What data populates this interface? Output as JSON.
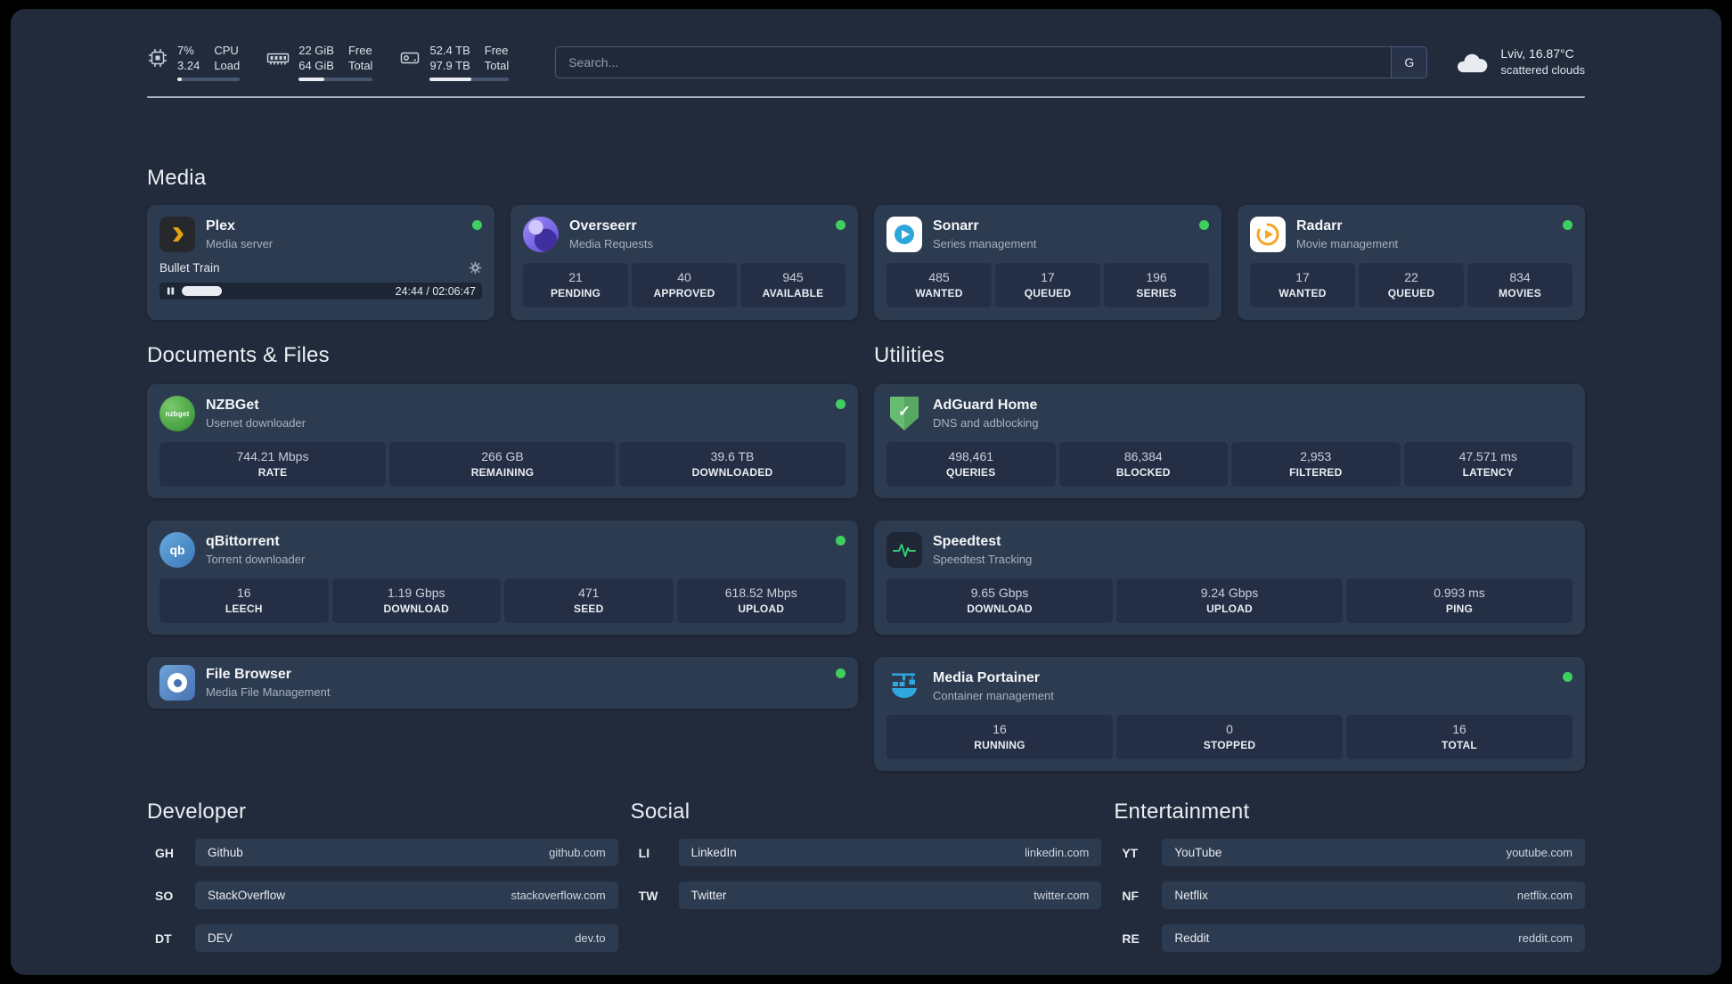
{
  "colors": {
    "background": "#212b3c",
    "card": "#2d3b50",
    "stat_box": "#242f46",
    "online_dot": "#3fcf5f",
    "speedtest_accent": "#2ecc71",
    "plex_amber": "#e5a00d"
  },
  "topbar": {
    "cpu": {
      "line1": "7%",
      "line2": "3.24",
      "label1": "CPU",
      "label2": "Load",
      "progress_pct": 7
    },
    "ram": {
      "line1": "22 GiB",
      "line2": "64 GiB",
      "label1": "Free",
      "label2": "Total",
      "progress_pct": 34
    },
    "disk": {
      "line1": "52.4 TB",
      "line2": "97.9 TB",
      "label1": "Free",
      "label2": "Total",
      "progress_pct": 53
    },
    "search": {
      "placeholder": "Search...",
      "engine_button": "G"
    },
    "weather": {
      "location": "Lviv, 16.87°C",
      "condition": "scattered clouds"
    }
  },
  "media": {
    "title": "Media",
    "plex": {
      "name": "Plex",
      "subtitle": "Media server",
      "now_playing": "Bullet Train",
      "time": "24:44 / 02:06:47",
      "progress_pct": 19.5
    },
    "overseerr": {
      "name": "Overseerr",
      "subtitle": "Media Requests",
      "stats": [
        {
          "value": "21",
          "label": "PENDING"
        },
        {
          "value": "40",
          "label": "APPROVED"
        },
        {
          "value": "945",
          "label": "AVAILABLE"
        }
      ]
    },
    "sonarr": {
      "name": "Sonarr",
      "subtitle": "Series management",
      "stats": [
        {
          "value": "485",
          "label": "WANTED"
        },
        {
          "value": "17",
          "label": "QUEUED"
        },
        {
          "value": "196",
          "label": "SERIES"
        }
      ]
    },
    "radarr": {
      "name": "Radarr",
      "subtitle": "Movie management",
      "stats": [
        {
          "value": "17",
          "label": "WANTED"
        },
        {
          "value": "22",
          "label": "QUEUED"
        },
        {
          "value": "834",
          "label": "MOVIES"
        }
      ]
    }
  },
  "documents": {
    "title": "Documents & Files",
    "nzbget": {
      "name": "NZBGet",
      "subtitle": "Usenet downloader",
      "icon_text": "nzbget",
      "stats": [
        {
          "value": "744.21 Mbps",
          "label": "RATE"
        },
        {
          "value": "266 GB",
          "label": "REMAINING"
        },
        {
          "value": "39.6 TB",
          "label": "DOWNLOADED"
        }
      ]
    },
    "qbittorrent": {
      "name": "qBittorrent",
      "subtitle": "Torrent downloader",
      "icon_text": "qb",
      "stats": [
        {
          "value": "16",
          "label": "LEECH"
        },
        {
          "value": "1.19 Gbps",
          "label": "DOWNLOAD"
        },
        {
          "value": "471",
          "label": "SEED"
        },
        {
          "value": "618.52 Mbps",
          "label": "UPLOAD"
        }
      ]
    },
    "filebrowser": {
      "name": "File Browser",
      "subtitle": "Media File Management"
    }
  },
  "utilities": {
    "title": "Utilities",
    "adguard": {
      "name": "AdGuard Home",
      "subtitle": "DNS and adblocking",
      "stats": [
        {
          "value": "498,461",
          "label": "QUERIES"
        },
        {
          "value": "86,384",
          "label": "BLOCKED"
        },
        {
          "value": "2,953",
          "label": "FILTERED"
        },
        {
          "value": "47.571 ms",
          "label": "LATENCY"
        }
      ]
    },
    "speedtest": {
      "name": "Speedtest",
      "subtitle": "Speedtest Tracking",
      "stats": [
        {
          "value": "9.65 Gbps",
          "label": "DOWNLOAD"
        },
        {
          "value": "9.24 Gbps",
          "label": "UPLOAD"
        },
        {
          "value": "0.993 ms",
          "label": "PING"
        }
      ]
    },
    "portainer": {
      "name": "Media Portainer",
      "subtitle": "Container management",
      "stats": [
        {
          "value": "16",
          "label": "RUNNING"
        },
        {
          "value": "0",
          "label": "STOPPED"
        },
        {
          "value": "16",
          "label": "TOTAL"
        }
      ]
    }
  },
  "links": {
    "developer": {
      "title": "Developer",
      "items": [
        {
          "abbr": "GH",
          "name": "Github",
          "domain": "github.com"
        },
        {
          "abbr": "SO",
          "name": "StackOverflow",
          "domain": "stackoverflow.com"
        },
        {
          "abbr": "DT",
          "name": "DEV",
          "domain": "dev.to"
        }
      ]
    },
    "social": {
      "title": "Social",
      "items": [
        {
          "abbr": "LI",
          "name": "LinkedIn",
          "domain": "linkedin.com"
        },
        {
          "abbr": "TW",
          "name": "Twitter",
          "domain": "twitter.com"
        }
      ]
    },
    "entertainment": {
      "title": "Entertainment",
      "items": [
        {
          "abbr": "YT",
          "name": "YouTube",
          "domain": "youtube.com"
        },
        {
          "abbr": "NF",
          "name": "Netflix",
          "domain": "netflix.com"
        },
        {
          "abbr": "RE",
          "name": "Reddit",
          "domain": "reddit.com"
        }
      ]
    }
  }
}
